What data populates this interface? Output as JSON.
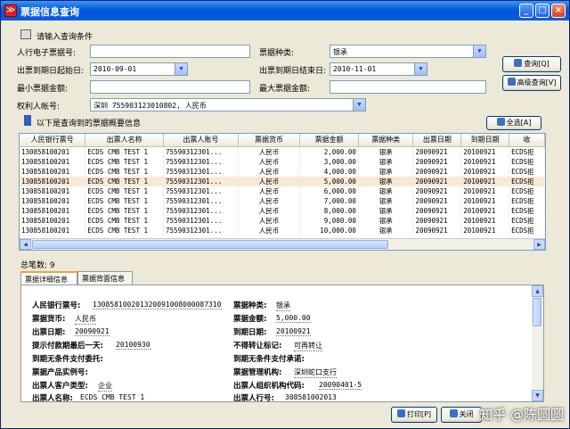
{
  "window": {
    "title": "票据信息查询"
  },
  "query_section": {
    "title": "请输入查询条件"
  },
  "fields": {
    "bill_no_label": "人行电子票据号:",
    "bill_no_value": "",
    "bill_type_label": "票据种类:",
    "bill_type_value": "银承",
    "issue_start_label": "出票到期日起始日:",
    "issue_start_value": "2010-09-01",
    "due_end_label": "出票到期日结束日:",
    "due_end_value": "2010-11-01",
    "min_amount_label": "最小票据金额:",
    "min_amount_value": "",
    "max_amount_label": "最大票据金额:",
    "max_amount_value": "",
    "account_label": "权利人帐号:",
    "account_value": "深圳  755903123010802,  人民币"
  },
  "buttons": {
    "query": "查询[Q]",
    "advanced": "高级查询[V]",
    "select_all": "全选[A]",
    "print": "打印[P]",
    "close": "关闭"
  },
  "results_section": {
    "title": "以下是查询到的票据概要信息"
  },
  "table": {
    "columns": [
      "人民银行票号",
      "出票人名称",
      "出票人账号",
      "票据货币",
      "票据金额",
      "票据种类",
      "出票日期",
      "到期日期",
      "收"
    ],
    "rows": [
      [
        "130858100201",
        "ECDS CMB TEST 1",
        "75590312301...",
        "人民币",
        "2,000.00",
        "银承",
        "20090921",
        "20100921",
        "ECDS拒"
      ],
      [
        "130858100201",
        "ECDS CMB TEST 1",
        "75590312301...",
        "人民币",
        "3,000.00",
        "银承",
        "20090921",
        "20100921",
        "ECDS拒"
      ],
      [
        "130858100201",
        "ECDS CMB TEST 1",
        "75590312301...",
        "人民币",
        "4,000.00",
        "银承",
        "20090921",
        "20100921",
        "ECDS拒"
      ],
      [
        "130858100201",
        "ECDS CMB TEST 1",
        "75590312301...",
        "人民币",
        "5,000.00",
        "银承",
        "20090921",
        "20100921",
        "ECDS拒"
      ],
      [
        "130858100201",
        "ECDS CMB TEST 1",
        "75590312301...",
        "人民币",
        "6,000.00",
        "银承",
        "20090921",
        "20100921",
        "ECDS拒"
      ],
      [
        "130858100201",
        "ECDS CMB TEST 1",
        "75590312301...",
        "人民币",
        "7,000.00",
        "银承",
        "20090921",
        "20100921",
        "ECDS拒"
      ],
      [
        "130858100201",
        "ECDS CMB TEST 1",
        "75590312301...",
        "人民币",
        "8,000.00",
        "银承",
        "20090921",
        "20100921",
        "ECDS拒"
      ],
      [
        "130858100201",
        "ECDS CMB TEST 1",
        "75590312301...",
        "人民币",
        "9,000.00",
        "银承",
        "20090921",
        "20100921",
        "ECDS拒"
      ],
      [
        "130858100201",
        "ECDS CMB TEST 1",
        "75590312301...",
        "人民币",
        "10,000.00",
        "银承",
        "20090921",
        "20100921",
        "ECDS拒"
      ]
    ]
  },
  "total": "总笔数: 9",
  "tabs": [
    "票据详细信息",
    "票据背面信息"
  ],
  "detail": {
    "bank_bill_no_label": "人民银行票号:",
    "bank_bill_no": "130858100201320091008000087310",
    "bill_type_label": "票据种类:",
    "bill_type": "银承",
    "currency_label": "票据货币:",
    "currency": "人民币",
    "amount_label": "票据金额:",
    "amount": "5,000.00",
    "issue_date_label": "出票日期:",
    "issue_date": "20090921",
    "due_date_label": "到期日期:",
    "due_date": "20100921",
    "prompt_date_label": "提示付款期最后一天:",
    "prompt_date": "20100930",
    "no_transfer_label": "不得转让标记:",
    "no_transfer": "可再转让",
    "unconditional_label": "到期无条件支付委托:",
    "unconditional": "",
    "unconditional_promise_label": "到期无条件支付承诺:",
    "unconditional_promise": "",
    "product_label": "票据产品实例号:",
    "product": "",
    "manage_org_label": "票据管理机构:",
    "manage_org": "深圳蛇口支行",
    "drawer_type_label": "出票人客户类型:",
    "drawer_type": "企业",
    "drawer_org_label": "出票人组织机构代码:",
    "drawer_org": "20090401-5",
    "drawer_name_label": "出票人名称:",
    "drawer_name": "ECDS CMB TEST 1",
    "drawer_bank_label": "出票人行号:",
    "drawer_bank": "308581002013"
  },
  "watermark": "知乎 @陈圆圆"
}
